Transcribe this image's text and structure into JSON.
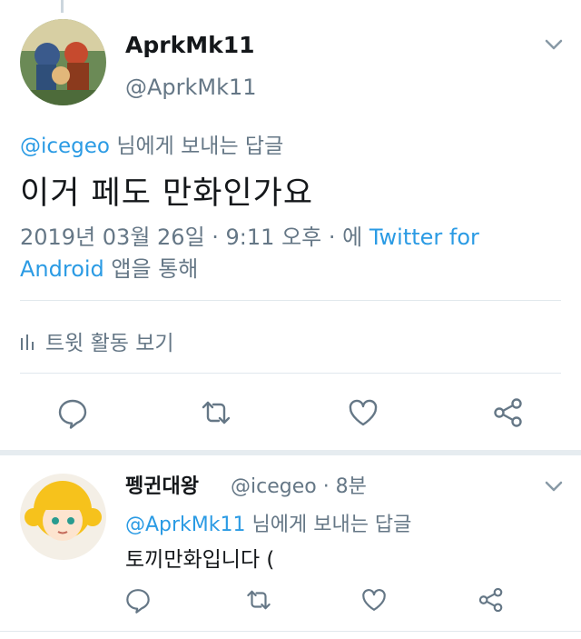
{
  "tweet": {
    "display_name": "AprkMk11",
    "handle": "@AprkMk11",
    "reply_to_handle": "@icegeo",
    "reply_to_suffix": " 님에게 보내는 답글",
    "text": "이거 페도 만화인가요",
    "timestamp": "2019년 03월 26일 · 9:11 오후 · 에 ",
    "client": "Twitter for Android",
    "client_suffix": " 앱을 통해",
    "activity_label": "트윗 활동 보기"
  },
  "reply": {
    "display_name": "펭귄대왕",
    "handle_time": "@icegeo · 8분",
    "reply_to_handle": "@AprkMk11",
    "reply_to_suffix": " 님에게 보내는 답글",
    "text": "토끼만화입니다 ("
  },
  "colors": {
    "link": "#2b9be4",
    "muted": "#657786",
    "text": "#14171a"
  },
  "icons": {
    "reply": "speech-bubble-icon",
    "retweet": "retweet-icon",
    "like": "heart-icon",
    "share": "share-icon",
    "more": "chevron-down-icon"
  }
}
